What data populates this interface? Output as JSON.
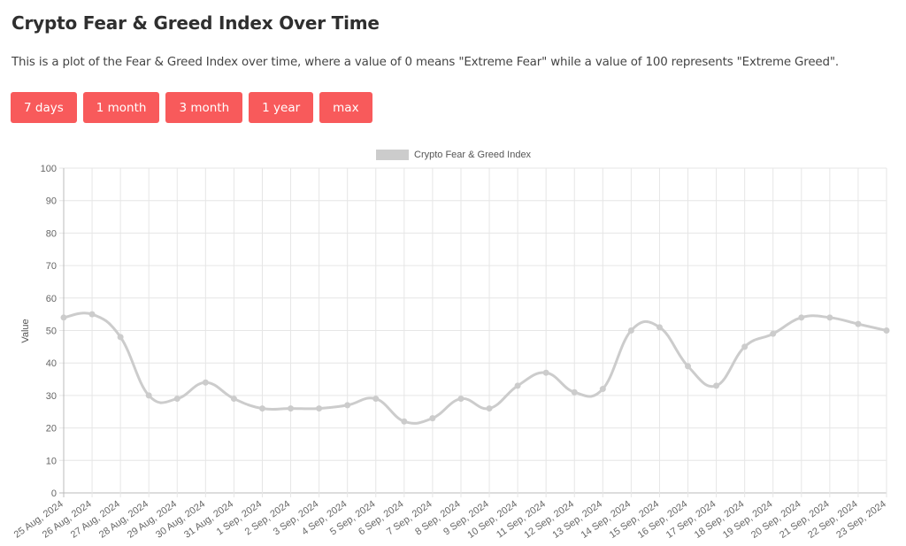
{
  "page": {
    "title": "Crypto Fear & Greed Index Over Time",
    "description": "This is a plot of the Fear & Greed Index over time, where a value of 0 means \"Extreme Fear\" while a value of 100 represents \"Extreme Greed\".",
    "buttons": [
      {
        "label": "7 days"
      },
      {
        "label": "1 month"
      },
      {
        "label": "3 month"
      },
      {
        "label": "1 year"
      },
      {
        "label": "max"
      }
    ],
    "colors": {
      "button_bg": "#f85a5b",
      "series": "#cccccc",
      "grid": "#e6e6e6"
    }
  },
  "chart_data": {
    "type": "line",
    "title": "",
    "xlabel": "",
    "ylabel": "Value",
    "ylim": [
      0,
      100
    ],
    "yticks": [
      0,
      10,
      20,
      30,
      40,
      50,
      60,
      70,
      80,
      90,
      100
    ],
    "grid": true,
    "legend": {
      "position": "top-center",
      "entries": [
        "Crypto Fear & Greed Index"
      ]
    },
    "categories": [
      "25 Aug, 2024",
      "26 Aug, 2024",
      "27 Aug, 2024",
      "28 Aug, 2024",
      "29 Aug, 2024",
      "30 Aug, 2024",
      "31 Aug, 2024",
      "1 Sep, 2024",
      "2 Sep, 2024",
      "3 Sep, 2024",
      "4 Sep, 2024",
      "5 Sep, 2024",
      "6 Sep, 2024",
      "7 Sep, 2024",
      "8 Sep, 2024",
      "9 Sep, 2024",
      "10 Sep, 2024",
      "11 Sep, 2024",
      "12 Sep, 2024",
      "13 Sep, 2024",
      "14 Sep, 2024",
      "15 Sep, 2024",
      "16 Sep, 2024",
      "17 Sep, 2024",
      "18 Sep, 2024",
      "19 Sep, 2024",
      "20 Sep, 2024",
      "21 Sep, 2024",
      "22 Sep, 2024",
      "23 Sep, 2024"
    ],
    "series": [
      {
        "name": "Crypto Fear & Greed Index",
        "values": [
          54,
          55,
          48,
          30,
          29,
          34,
          29,
          26,
          26,
          26,
          27,
          29,
          22,
          23,
          29,
          26,
          33,
          37,
          31,
          32,
          50,
          51,
          39,
          33,
          45,
          49,
          54,
          54,
          52,
          50
        ]
      }
    ]
  }
}
